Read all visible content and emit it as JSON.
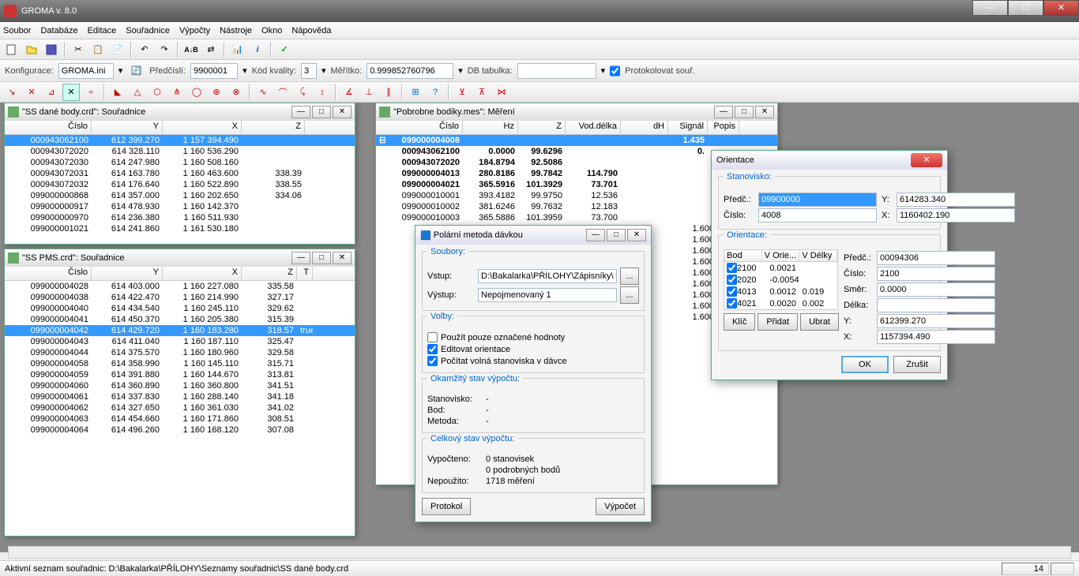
{
  "app": {
    "title": "GROMA v. 8.0"
  },
  "menu": [
    "Soubor",
    "Databáze",
    "Editace",
    "Souřadnice",
    "Výpočty",
    "Nástroje",
    "Okno",
    "Nápověda"
  ],
  "config": {
    "konfigurace_label": "Konfigurace:",
    "konfigurace_value": "GROMA.ini",
    "predcisli_label": "Předčíslí:",
    "predcisli_value": "9900001",
    "kod_label": "Kód kvality:",
    "kod_value": "3",
    "meritko_label": "Měřítko:",
    "meritko_value": "0.999852760796",
    "db_label": "DB tabulka:",
    "db_value": "",
    "protokol_label": "Protokolovat souř."
  },
  "win1": {
    "title": "\"SS dané body.crd\": Souřadnice",
    "cols": [
      "Číslo",
      "Y",
      "X",
      "Z"
    ],
    "widths": [
      110,
      90,
      100,
      80
    ],
    "rows": [
      [
        "000943062100",
        "612 399.270",
        "1 157 394.490",
        "",
        true
      ],
      [
        "000943072020",
        "614 328.110",
        "1 160 536.290",
        ""
      ],
      [
        "000943072030",
        "614 247.980",
        "1 160 508.160",
        ""
      ],
      [
        "000943072031",
        "614 163.780",
        "1 160 463.600",
        "338.39"
      ],
      [
        "000943072032",
        "614 176.640",
        "1 160 522.890",
        "338.55"
      ],
      [
        "099000000868",
        "614 357.000",
        "1 160 202.650",
        "334.06"
      ],
      [
        "099000000917",
        "614 478.930",
        "1 160 142.370",
        ""
      ],
      [
        "099000000970",
        "614 236.380",
        "1 160 511.930",
        ""
      ],
      [
        "099000001021",
        "614 241.860",
        "1 161 530.180",
        ""
      ]
    ]
  },
  "win2": {
    "title": "\"SS PMS.crd\": Souřadnice",
    "cols": [
      "Číslo",
      "Y",
      "X",
      "Z",
      "T"
    ],
    "widths": [
      110,
      90,
      100,
      70,
      20
    ],
    "rows": [
      [
        "099000004028",
        "614 403.000",
        "1 160 227.080",
        "335.58"
      ],
      [
        "099000004038",
        "614 422.470",
        "1 160 214.990",
        "327.17"
      ],
      [
        "099000004040",
        "614 434.540",
        "1 160 245.110",
        "329.62"
      ],
      [
        "099000004041",
        "614 450.370",
        "1 160 205.380",
        "315.39"
      ],
      [
        "099000004042",
        "614 429.720",
        "1 160 183.280",
        "318.57",
        true
      ],
      [
        "099000004043",
        "614 411.040",
        "1 160 187.110",
        "325.47"
      ],
      [
        "099000004044",
        "614 375.570",
        "1 160 180.960",
        "329.58"
      ],
      [
        "099000004058",
        "614 358.990",
        "1 160 145.110",
        "315.71"
      ],
      [
        "099000004059",
        "614 391.880",
        "1 160 144.670",
        "313.81"
      ],
      [
        "099000004060",
        "614 360.890",
        "1 160 360.800",
        "341.51"
      ],
      [
        "099000004061",
        "614 337.830",
        "1 160 288.140",
        "341.18"
      ],
      [
        "099000004062",
        "614 327.650",
        "1 160 361.030",
        "341.02"
      ],
      [
        "099000004063",
        "614 454.660",
        "1 160 171.860",
        "308.51"
      ],
      [
        "099000004064",
        "614 496.260",
        "1 160 168.120",
        "307.08"
      ]
    ]
  },
  "win3": {
    "title": "\"Pobrobne bodiky.mes\": Měření",
    "cols": [
      "Číslo",
      "Hz",
      "Z",
      "Vod.délka",
      "dH",
      "Signál",
      "Popis"
    ],
    "widths": [
      110,
      70,
      60,
      70,
      60,
      50,
      40
    ],
    "rows": [
      [
        "099000004008",
        "",
        "",
        "",
        "",
        "1.435",
        "",
        true,
        true
      ],
      [
        "000943062100",
        "0.0000",
        "99.6296",
        "",
        "",
        "0.",
        "",
        true
      ],
      [
        "000943072020",
        "184.8794",
        "92.5086",
        "",
        "",
        "",
        "",
        true
      ],
      [
        "099000004013",
        "280.8186",
        "99.7842",
        "114.790",
        "",
        "",
        "",
        true
      ],
      [
        "099000004021",
        "365.5916",
        "101.3929",
        "73.701",
        "",
        "",
        "",
        true
      ],
      [
        "099000010001",
        "393.4182",
        "99.9750",
        "12.536",
        "",
        "",
        ""
      ],
      [
        "099000010002",
        "381.6246",
        "99.7632",
        "12.183",
        "",
        "",
        ""
      ],
      [
        "099000010003",
        "365.5886",
        "101.3959",
        "73.700",
        "",
        "",
        ""
      ]
    ],
    "tail_signals": [
      "1.600",
      "1.600",
      "1.600",
      "1.600",
      "1.600",
      "1.600",
      "1.600",
      "1.600",
      "1.600"
    ]
  },
  "dlg_polar": {
    "title": "Polární metoda dávkou",
    "soubory": "Soubory:",
    "vstup_label": "Vstup:",
    "vstup_value": "D:\\Bakalarka\\PŘÍLOHY\\Zápisníky\\Pot",
    "vystup_label": "Výstup:",
    "vystup_value": "Nepojmenovaný 1",
    "volby": "Volby:",
    "o1": "Použít pouze označené hodnoty",
    "o2": "Editovat orientace",
    "o3": "Počítat volná stanoviska v dávce",
    "okamzity": "Okamžitý stav výpočtu:",
    "stanovisko": "Stanovisko:",
    "bod": "Bod:",
    "metoda": "Metoda:",
    "celkovy": "Celkový stav výpočtu:",
    "vypocteno": "Vypočteno:",
    "vyp1": "0  stanovisek",
    "vyp2": "0  podrobných bodů",
    "nepouzito": "Nepoužito:",
    "nep1": "1718  měření",
    "btn_protokol": "Protokol",
    "btn_vypocet": "Výpočet"
  },
  "dlg_orient": {
    "title": "Orientace",
    "stanovisko": "Stanovisko:",
    "predc_label": "Předč.:",
    "predc_value": "09900000",
    "cislo_label": "Číslo:",
    "cislo_value": "4008",
    "y_label": "Y:",
    "y_value": "614283.340",
    "x_label": "X:",
    "x_value": "1160402.190",
    "orientace": "Orientace:",
    "th": [
      "Bod",
      "V Orie...",
      "V Délky"
    ],
    "rows": [
      [
        "2100",
        "0.0021",
        ""
      ],
      [
        "2020",
        "-0.0054",
        ""
      ],
      [
        "4013",
        "0.0012",
        "0.019"
      ],
      [
        "4021",
        "0.0020",
        "0.002"
      ]
    ],
    "predc2_label": "Předč.:",
    "predc2_value": "00094306",
    "cislo2_label": "Číslo:",
    "cislo2_value": "2100",
    "smer_label": "Směr:",
    "smer_value": "0.0000",
    "delka_label": "Délka:",
    "delka_value": "",
    "y2_label": "Y:",
    "y2_value": "612399.270",
    "x2_label": "X:",
    "x2_value": "1157394.490",
    "btn_klic": "Klíč",
    "btn_pridat": "Přidat",
    "btn_ubrat": "Ubrat",
    "btn_ok": "OK",
    "btn_zrusit": "Zrušit"
  },
  "status": {
    "text": "Aktivní seznam souřadnic:  D:\\Bakalarka\\PŘÍLOHY\\Seznamy souřadnic\\SS dané body.crd",
    "num": "14"
  }
}
